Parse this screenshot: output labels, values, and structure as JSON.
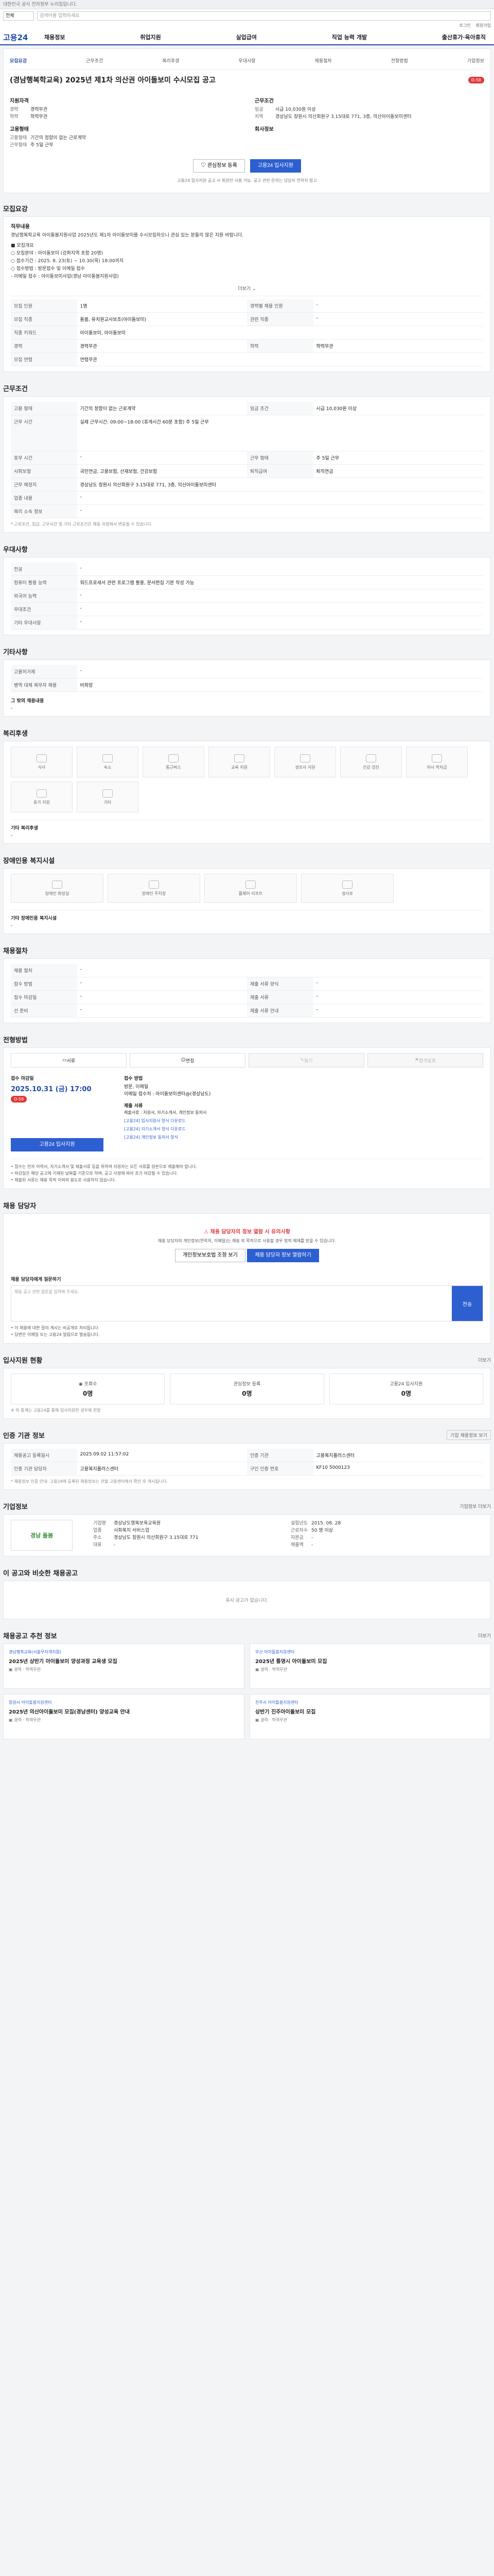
{
  "topbar": {
    "notice": "대한민국 공식 전자정부 누리집입니다."
  },
  "search": {
    "select": "전체",
    "placeholder": "검색어를 입력하세요"
  },
  "util": {
    "login": "로그인",
    "join": "회원가입"
  },
  "gnb": {
    "logo": "고용24",
    "menu": [
      "채용정보",
      "취업지원",
      "실업급여",
      "직업 능력 개발",
      "출산휴가·육아휴직"
    ]
  },
  "job": {
    "tabs": [
      "모집요강",
      "근무조건",
      "복리후생",
      "우대사항",
      "채용절차",
      "전형방법",
      "기업정보"
    ],
    "title": "(경남행복학교육) 2025년 제1차 의산권 아이돌보미 수시모집 공고",
    "dday": "D-58",
    "company_h": "지원자격",
    "company_rows": [
      {
        "k": "경력",
        "v": "경력무관"
      },
      {
        "k": "학력",
        "v": "학력무관"
      }
    ],
    "cond_h": "근무조건",
    "cond_rows": [
      {
        "k": "임금",
        "v": "시급 10,030원 이상"
      },
      {
        "k": "지역",
        "v": "경상남도 창원시 의산회원구 3.15대로 771, 3층, 의산아이돌보미센터"
      }
    ],
    "emp_h": "고용형태",
    "emp_rows": [
      {
        "k": "고용형태",
        "v": "기간의 정함이 없는 근로계약"
      },
      {
        "k": "근무형태",
        "v": "주 5일 근무"
      }
    ],
    "corp_h": "회사정보",
    "corp_rows": [
      {
        "k": "",
        "v": ""
      }
    ],
    "btn_scrap": "관심정보 등록",
    "btn_apply": "고용24 입사지원",
    "note": "고용24 입사지원 공고 시 회원만 사용 가능. 공고 관련 문의는 담당자 연락처 참고"
  },
  "recruit": {
    "title": "모집요강",
    "job_h": "직무내용",
    "job_text": "경남행복학교육 아이돌봄지원사업 2025년도 제1차 아이돌보미를 수시모집하오니 관심 있는 분들의 많은 지원 바랍니다.",
    "items": [
      "■ 모집개요",
      "○ 모집분야 : 아이돌보미 (강화지역 포함 20명)",
      "○ 접수기간 : 2025. 8. 23(토) ~ 10.30(목) 18:00까지",
      "○ 접수방법 : 방문접수 및 이메일 접수",
      "- 이메일 접수 : 아이돌보미사업(경남 아이돌봄지원사업)"
    ],
    "more": "더보기",
    "rows": [
      {
        "k1": "모집 인원",
        "v1": "1명",
        "k2": "경력별 채용 인원",
        "v2": "-"
      },
      {
        "k1": "모집 직종",
        "v1": "돌봄, 유치원교사보조(아이돌보미)",
        "k2": "관련 직종",
        "v2": "-"
      },
      {
        "k1": "직종 키워드",
        "v1": "아이돌보미, 아이돌보미",
        "k2": "",
        "v2": ""
      },
      {
        "k1": "경력",
        "v1": "경력무관",
        "k2": "학력",
        "v2": "학력무관"
      },
      {
        "k1": "모집 연령",
        "v1": "연령무관",
        "k2": "",
        "v2": ""
      }
    ]
  },
  "work": {
    "title": "근무조건",
    "rows": [
      {
        "k1": "고용 형태",
        "v1": "기간의 정함이 없는 근로계약",
        "k2": "임금 조건",
        "v2": "시급 10,030원 이상"
      },
      {
        "k1": "근무 시간",
        "v1": "실제 근무시간: 09:00~18:00 (휴게시간 60분 포함) 주 5일 근무",
        "k2": "",
        "v2": ""
      },
      {
        "k1": "휴무 시간",
        "v1": "-",
        "k2": "근무 형태",
        "v2": "주 5일 근무"
      },
      {
        "k1": "사회보험",
        "v1": "국민연금, 고용보험, 산재보험, 건강보험",
        "k2": "퇴직급여",
        "v2": "퇴직연금"
      },
      {
        "k1": "근무 예정지",
        "v1": "경상남도 창원시 의산회원구 3.15대로 771, 3층, 의산아이돌보미센터",
        "k2": "",
        "v2": ""
      },
      {
        "k1": "업종 내용",
        "v1": "-",
        "k2": "",
        "v2": ""
      },
      {
        "k1": "복리 소속 정보",
        "v1": "-",
        "k2": "",
        "v2": ""
      }
    ],
    "footnote": "* 근로조건, 임금, 근무시간 및 기타 근로조건은 채용 과정에서 변동될 수 있습니다."
  },
  "prefer": {
    "title": "우대사항",
    "rows": [
      {
        "k": "전공",
        "v": "-"
      },
      {
        "k": "컴퓨터 활용 능력",
        "v": "워드프로세서 관련 프로그램 활용, 문서편집 기본 작성 가능"
      },
      {
        "k": "외국어 능력",
        "v": "-"
      },
      {
        "k": "우대조건",
        "v": "-"
      },
      {
        "k": "기타 우대사항",
        "v": "-"
      }
    ]
  },
  "etc": {
    "title": "기타사항",
    "rows": [
      {
        "k": "고용허가제",
        "v": "-"
      },
      {
        "k": "병역 대체 복무자 채용",
        "v": "비희망"
      }
    ],
    "extra": "그 밖의 채용내용",
    "extra_v": "-"
  },
  "welfare": {
    "title": "복리후생",
    "icons": [
      "식사",
      "숙소",
      "통근버스",
      "교육 지원",
      "경조사 지원",
      "건강 검진",
      "자녀 학자금",
      "휴가 지원",
      "기타"
    ],
    "other_h": "기타 복리후생",
    "other_v": "-"
  },
  "disabled": {
    "title": "장애인용 복지시설",
    "icons": [
      "장애인 화장실",
      "장애인 주차장",
      "휠체어 리프트",
      "경사로",
      "점자 유도 블록"
    ],
    "other_h": "기타 장애인용 복지시설",
    "other_v": "-"
  },
  "process": {
    "title": "채용절차",
    "rows": [
      {
        "k1": "채용 절차",
        "v1": "-",
        "k2": "",
        "v2": ""
      },
      {
        "k1": "접수 방법",
        "v1": "-",
        "k2": "제출 서류 양식",
        "v2": "-"
      },
      {
        "k1": "접수 마감일",
        "v1": "-",
        "k2": "제출 서류",
        "v2": "-"
      },
      {
        "k1": "선 준비",
        "v1": "-",
        "k2": "제출 서류 안내",
        "v2": "-"
      }
    ]
  },
  "method": {
    "title": "전형방법",
    "tabs": [
      "서류",
      "면접",
      "필기",
      "합격발표"
    ],
    "deadline_h": "접수 마감일",
    "deadline": "2025.10.31 (금) 17:00",
    "dday": "D-58",
    "apply_h": "접수 방법",
    "apply_lines": [
      "방문, 이메일",
      "이메일 접수처 : 아이돌보미센터@(경상남도)"
    ],
    "docs_h": "제출 서류",
    "docs": [
      "제출서류 : 지원서, 자기소개서, 개인정보 동의서",
      "[고용24] 입사지원서 양식 다운로드",
      "[고용24] 자기소개서 양식 다운로드",
      "[고용24] 개인정보 동의서 양식"
    ],
    "btn_apply": "고용24 입사지원",
    "notes": [
      "• 접수는 전자 이력서, 자기소개서 및 제출서류 등을 위하여 지원자는 모든 서류를 원본으로 제출해야 합니다.",
      "• 마감일은 해당 공고에 기재된 날짜를 기준으로 하며, 공고 사정에 따라 조기 마감될 수 있습니다.",
      "• 제출된 서류는 채용 목적 이외의 용도로 사용하지 않습니다."
    ]
  },
  "contact": {
    "title": "채용 담당자",
    "alert": "채용 담당자의 정보 열람 시 유의사항",
    "desc": "채용 담당자의 개인정보(연락처, 이메일)는 채용 외 목적으로 사용할 경우 법적 제재를 받을 수 있습니다.",
    "btn1": "개인정보보호법 조항 보기",
    "btn2": "채용 담당자 정보 열람하기",
    "q_h": "채용 담당자에게 질문하기",
    "q_placeholder": "채용 공고 관련 질문을 입력해 주세요.",
    "q_btn": "전송",
    "q_notes": [
      "• 이 채용에 대한 질의 게시는 비공개로 처리됩니다.",
      "• 답변은 이메일 또는 고용24 알림으로 발송됩니다."
    ]
  },
  "stats": {
    "title": "입사지원 현황",
    "more": "더보기",
    "items": [
      {
        "label": "조회수",
        "value": "0명"
      },
      {
        "label": "관심정보 등록",
        "value": "0명"
      },
      {
        "label": "고용24 입사지원",
        "value": "0명"
      }
    ],
    "note": "※ 위 통계는 고용24를 통해 입사지원한 경우에 한함"
  },
  "info": {
    "title": "인증 기관 정보",
    "btn": "기업 채용정보 보기",
    "rows": [
      {
        "k1": "채용공고 등록일시",
        "v1": "2025.09.02 11:57:02",
        "k2": "인증 기관",
        "v2": "고용복지플러스센터"
      },
      {
        "k1": "인증 기관 담당자",
        "v1": "고용복지플러스센터",
        "k2": "구인 인증 번호",
        "v2": "KF10 5000123"
      }
    ],
    "note": "* 채용정보 인증 안내: 고용24에 등록된 채용정보는 관할 고용센터에서 확인 후 게시됩니다."
  },
  "company": {
    "title": "기업정보",
    "more": "기업정보 더보기",
    "logo": "경남 돌봄",
    "rows1": [
      {
        "k": "기업명",
        "v": "경상남도행복보육교육원"
      },
      {
        "k": "업종",
        "v": "사회복지 서비스업"
      },
      {
        "k": "주소",
        "v": "경상남도 창원시 의산회원구 3.15대로 771"
      },
      {
        "k": "대표",
        "v": "-"
      }
    ],
    "rows2": [
      {
        "k": "설립년도",
        "v": "2015. 08. 28"
      },
      {
        "k": "근로자수",
        "v": "50 명 이상"
      },
      {
        "k": "자본금",
        "v": "-"
      },
      {
        "k": "매출액",
        "v": "-"
      }
    ]
  },
  "similar": {
    "title": "이 공고와 비슷한 채용공고",
    "empty": "유사 공고가 없습니다."
  },
  "recommend": {
    "title": "채용공고 추천 정보",
    "more": "더보기",
    "items": [
      {
        "tag": "경남행복교육(서울무지개지점)",
        "title": "2025년 상반기 아이돌보미 양성과정 교육생 모집",
        "m1": "경력",
        "m2": "학력무관"
      },
      {
        "tag": "부산 아이돌봄지원센터",
        "title": "2025년 통영시 아이돌보미 모집",
        "m1": "경력",
        "m2": "학력무관"
      },
      {
        "tag": "창원시 아이돌봄지원센터",
        "title": "2025년 의산아이돌보미 모집(경남센터) 양성교육 안내",
        "m1": "경력",
        "m2": "학력무관"
      },
      {
        "tag": "진주시 아이돌봄지원센터",
        "title": "상반기 진주아이돌보미 모집",
        "m1": "경력",
        "m2": "학력무관"
      }
    ]
  }
}
